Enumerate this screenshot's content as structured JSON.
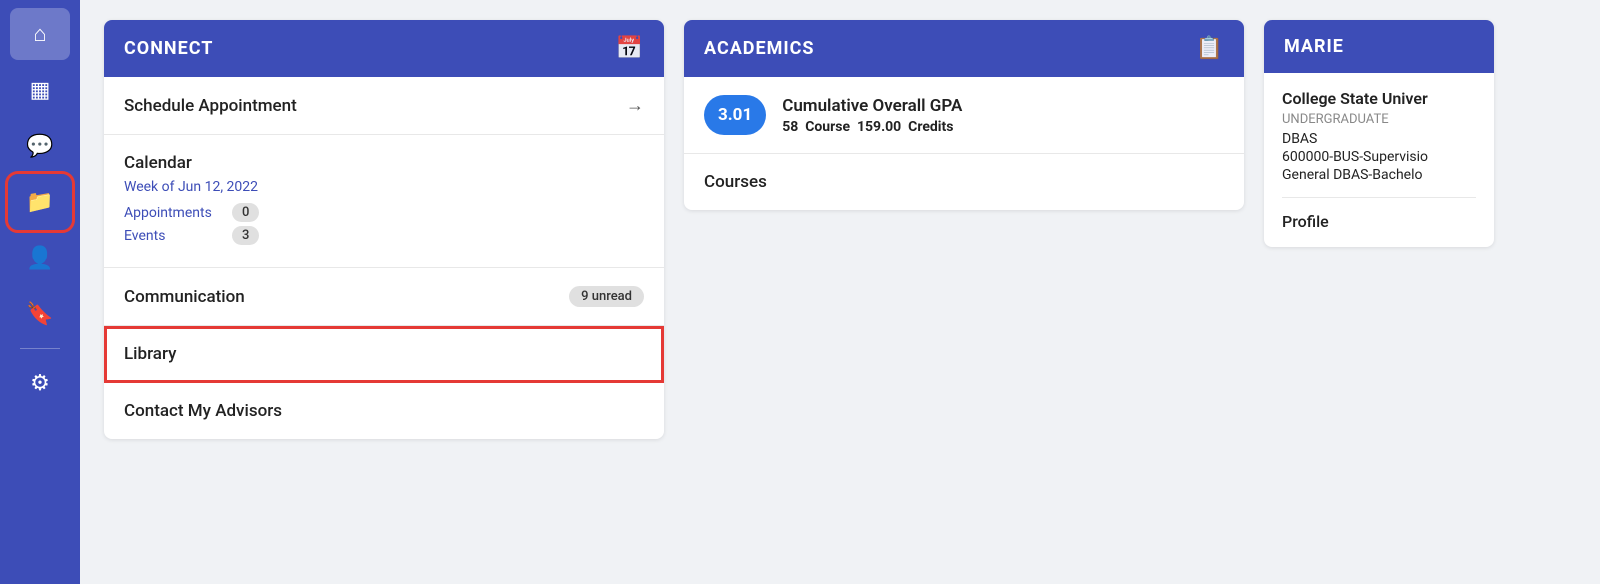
{
  "sidebar": {
    "items": [
      {
        "name": "home",
        "icon": "⌂",
        "active": false
      },
      {
        "name": "calendar",
        "icon": "📅",
        "active": false
      },
      {
        "name": "messages",
        "icon": "💬",
        "active": false
      },
      {
        "name": "folder",
        "icon": "📁",
        "active": true,
        "highlighted": true
      },
      {
        "name": "profile-person",
        "icon": "👤",
        "active": false
      },
      {
        "name": "bookmark",
        "icon": "🔖",
        "active": false
      },
      {
        "name": "settings",
        "icon": "⚙",
        "active": false
      }
    ]
  },
  "connect": {
    "header": "CONNECT",
    "schedule_label": "Schedule Appointment",
    "schedule_arrow": "→",
    "calendar_label": "Calendar",
    "calendar_week": "Week of Jun 12, 2022",
    "appointments_label": "Appointments",
    "appointments_count": "0",
    "events_label": "Events",
    "events_count": "3",
    "communication_label": "Communication",
    "unread_label": "9 unread",
    "library_label": "Library",
    "contact_label": "Contact My Advisors"
  },
  "academics": {
    "header": "ACADEMICS",
    "gpa_value": "3.01",
    "gpa_title": "Cumulative Overall GPA",
    "course_count": "58",
    "course_label": "Course",
    "credits_value": "159.00",
    "credits_label": "Credits",
    "courses_link": "Courses"
  },
  "marie": {
    "header": "MARIE",
    "university": "College State Univer",
    "level": "UNDERGRADUATE",
    "program": "DBAS",
    "code": "600000-BUS-Supervisio",
    "degree": "General DBAS-Bachelo",
    "profile_label": "Profile"
  }
}
